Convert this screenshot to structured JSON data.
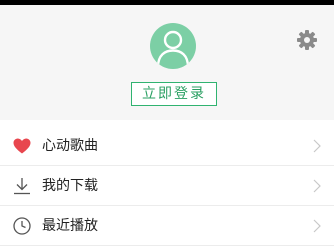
{
  "profile": {
    "login_label": "立即登录",
    "avatar_icon": "user-avatar-icon",
    "settings_icon": "gear-icon"
  },
  "menu": {
    "items": [
      {
        "label": "心动歌曲",
        "icon": "heart-icon",
        "icon_color": "#e8464e"
      },
      {
        "label": "我的下载",
        "icon": "download-icon"
      },
      {
        "label": "最近播放",
        "icon": "clock-icon"
      }
    ]
  },
  "colors": {
    "accent": "#30b370",
    "avatar_bg": "#7ccfa5",
    "header_bg": "#f6f6f6"
  }
}
